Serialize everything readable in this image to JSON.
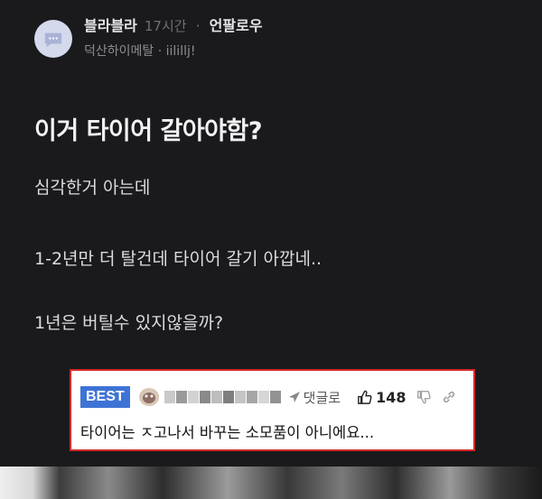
{
  "post": {
    "author": "블라블라",
    "time": "17시간",
    "separator": "·",
    "follow_label": "언팔로우",
    "channel_line": "덕산하이메탈 · iilillj!",
    "title": "이거 타이어 갈아야함?",
    "body": [
      "심각한거 아는데",
      "1-2년만 더 탈건데 타이어 갈기 아깝네..",
      "1년은 버틸수 있지않을까?"
    ]
  },
  "best_comment": {
    "badge": "BEST",
    "reply_label": "댓글로",
    "likes": "148",
    "text": "타이어는 ㅈ고나서 바꾸는 소모품이 아니에요..."
  },
  "icons": {
    "avatar": "speech-bubble-icon",
    "reply": "reply-arrow-icon",
    "like": "thumbs-up-icon",
    "dislike": "thumbs-down-icon",
    "link": "link-icon"
  }
}
